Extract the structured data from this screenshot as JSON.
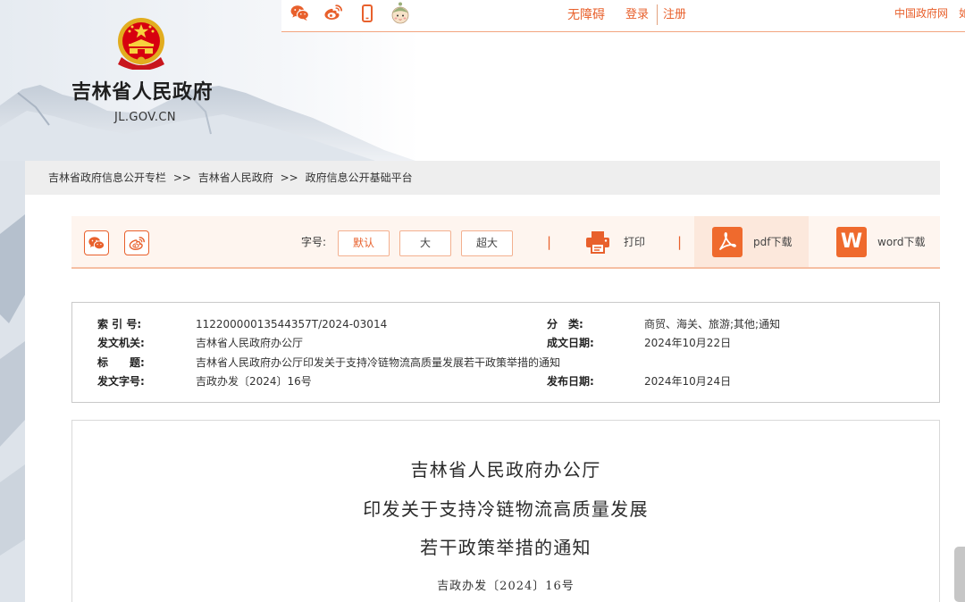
{
  "colors": {
    "accent": "#e8602c",
    "accent_border": "#f3b08f",
    "toolbar_bg": "#fef5ef",
    "pdf_bg": "#fce8dc",
    "breadcrumb_bg": "#eeeeee"
  },
  "header": {
    "site_name": "吉林省人民政府",
    "domain": "JL.GOV.CN",
    "emblem_icon": "national-emblem-icon",
    "icons": [
      "wechat-icon",
      "weibo-icon",
      "mobile-phone-icon",
      "mascot-icon"
    ],
    "links": {
      "accessibility": "无障碍",
      "login": "登录",
      "register": "注册",
      "gov_portal": "中国政府网",
      "cut_off": "如"
    }
  },
  "breadcrumb": {
    "separator": ">>",
    "items": [
      "吉林省政府信息公开专栏",
      "吉林省人民政府",
      "政府信息公开基础平台"
    ]
  },
  "toolbar": {
    "share_icons": [
      "wechat-icon",
      "weibo-icon"
    ],
    "font_size_label": "字号:",
    "font_sizes": [
      "默认",
      "大",
      "超大"
    ],
    "selected_font_size_index": 0,
    "divider": "|",
    "print_icon": "printer-icon",
    "print_label": "打印",
    "pdf_icon": "pdf-icon",
    "pdf_label": "pdf下载",
    "word_icon_letter": "W",
    "word_label": "word下载"
  },
  "metadata": {
    "rows": [
      {
        "label": "索 引 号:",
        "value": "11220000013544357T/2024-03014",
        "label2": "分　类:",
        "value2": "商贸、海关、旅游;其他;通知"
      },
      {
        "label": "发文机关:",
        "value": "吉林省人民政府办公厅",
        "label2": "成文日期:",
        "value2": "2024年10月22日"
      },
      {
        "label": "标　　题:",
        "value": "吉林省人民政府办公厅印发关于支持冷链物流高质量发展若干政策举措的通知"
      },
      {
        "label": "发文字号:",
        "value": "吉政办发〔2024〕16号",
        "label2": "发布日期:",
        "value2": "2024年10月24日"
      }
    ]
  },
  "article": {
    "title_lines": [
      "吉林省人民政府办公厅",
      "印发关于支持冷链物流高质量发展",
      "若干政策举措的通知"
    ],
    "doc_number": "吉政办发〔2024〕16号"
  }
}
